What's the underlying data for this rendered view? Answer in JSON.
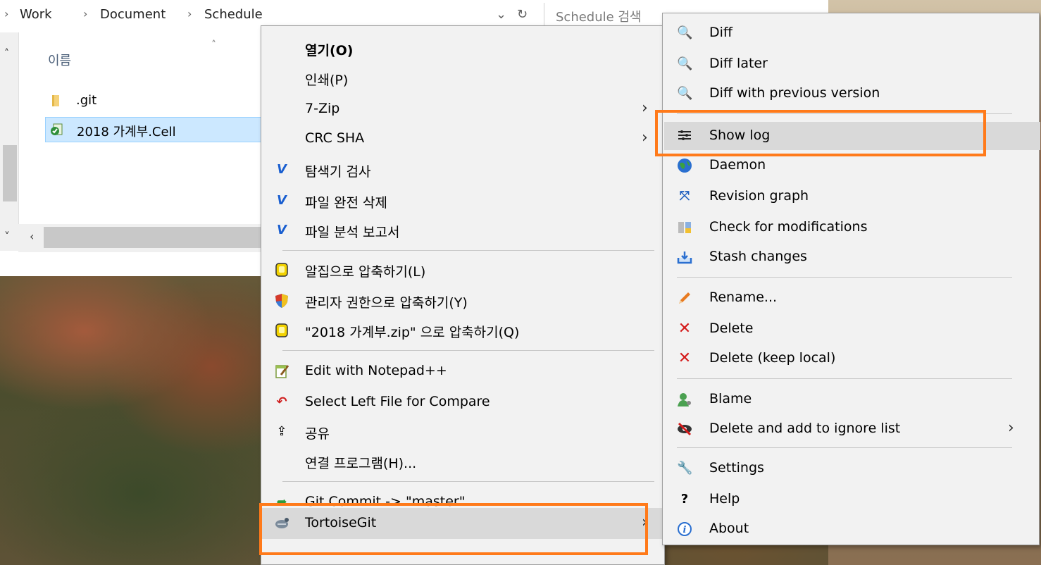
{
  "explorer": {
    "breadcrumb": [
      "Work",
      "Document",
      "Schedule"
    ],
    "search_placeholder": "Schedule 검색",
    "column_name": "이름",
    "files": [
      {
        "name": ".git",
        "icon": "folder-icon",
        "selected": false
      },
      {
        "name": "2018 가계부.Cell",
        "icon": "cell-file-icon",
        "selected": true
      }
    ]
  },
  "context_menu": {
    "items": [
      {
        "label": "열기(O)",
        "bold": true
      },
      {
        "label": "인쇄(P)"
      },
      {
        "label": "7-Zip",
        "submenu": true
      },
      {
        "label": "CRC SHA",
        "submenu": true
      },
      {
        "label": "탐색기 검사",
        "icon": "v3-icon"
      },
      {
        "label": "파일 완전 삭제",
        "icon": "v3-shred-icon"
      },
      {
        "label": "파일 분석 보고서",
        "icon": "v3-report-icon"
      },
      {
        "label": "알집으로 압축하기(L)",
        "icon": "alzip-icon"
      },
      {
        "label": "관리자 권한으로 압축하기(Y)",
        "icon": "admin-shield-icon"
      },
      {
        "label": "\"2018 가계부.zip\" 으로 압축하기(Q)",
        "icon": "alzip-icon"
      },
      {
        "label": "Edit with Notepad++",
        "icon": "notepad-icon"
      },
      {
        "label": "Select Left File for Compare",
        "icon": "compare-icon"
      },
      {
        "label": "공유",
        "icon": "share-icon"
      },
      {
        "label": "연결 프로그램(H)..."
      },
      {
        "label": "Git Commit -> \"master\"",
        "icon": "git-commit-icon"
      },
      {
        "label": "TortoiseGit",
        "icon": "tortoisegit-icon",
        "submenu": true,
        "highlighted": true
      }
    ]
  },
  "submenu": {
    "items": [
      {
        "label": "Diff",
        "icon": "magnifier-icon"
      },
      {
        "label": "Diff later",
        "icon": "magnifier-icon"
      },
      {
        "label": "Diff with previous version",
        "icon": "magnifier-icon"
      },
      {
        "label": "Show log",
        "icon": "log-icon",
        "highlighted": true
      },
      {
        "label": "Daemon",
        "icon": "globe-icon"
      },
      {
        "label": "Revision graph",
        "icon": "revision-graph-icon"
      },
      {
        "label": "Check for modifications",
        "icon": "check-mods-icon"
      },
      {
        "label": "Stash changes",
        "icon": "stash-icon"
      },
      {
        "label": "Rename...",
        "icon": "pencil-icon"
      },
      {
        "label": "Delete",
        "icon": "red-x-icon"
      },
      {
        "label": "Delete (keep local)",
        "icon": "red-x-icon"
      },
      {
        "label": "Blame",
        "icon": "blame-icon"
      },
      {
        "label": "Delete and add to ignore list",
        "icon": "ignore-icon",
        "submenu": true
      },
      {
        "label": "Settings",
        "icon": "wrench-icon"
      },
      {
        "label": "Help",
        "icon": "help-icon"
      },
      {
        "label": "About",
        "icon": "info-icon"
      }
    ]
  },
  "colors": {
    "highlight_border": "#ff7a1a",
    "menu_bg": "#f2f2f2",
    "selection": "#cce8ff"
  }
}
